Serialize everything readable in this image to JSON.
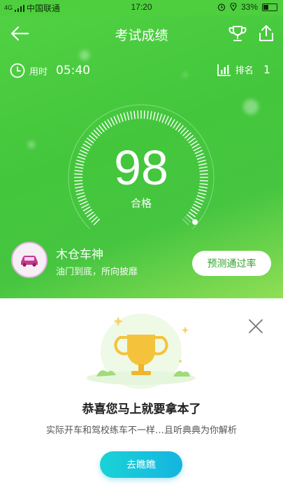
{
  "status_bar": {
    "signal_text": "4G",
    "carrier": "中国联通",
    "time": "17:20",
    "battery": "33%"
  },
  "header": {
    "title": "考试成绩"
  },
  "stats": {
    "time_label": "用时",
    "time_value": "05:40",
    "rank_label": "排名",
    "rank_value": "1"
  },
  "score": {
    "value": "98",
    "status": "合格",
    "fraction": 0.98
  },
  "user": {
    "title": "木仓车神",
    "subtitle": "油门到底，所向披靡",
    "predict_button": "预测通过率"
  },
  "promo": {
    "title": "恭喜您马上就要拿本了",
    "description": "实际开车和驾校练车不一样…且听典典为你解析",
    "button": "去瞧瞧"
  },
  "colors": {
    "primary_green": "#4ecf3e",
    "button_cyan": "#19c7db",
    "trophy_gold": "#f5c33b"
  }
}
